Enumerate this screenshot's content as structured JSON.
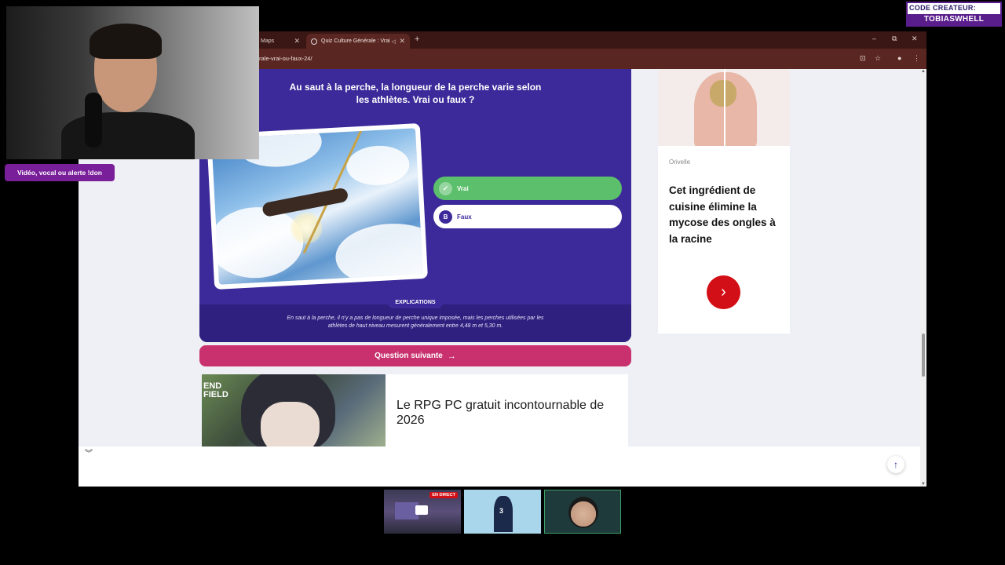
{
  "browser": {
    "tabs": [
      {
        "label": "Maps"
      },
      {
        "label": "Quiz Culture Générale : Vrai"
      }
    ],
    "new_tab": "+",
    "window_controls": {
      "minimize": "–",
      "restore": "⧉",
      "close": "✕"
    },
    "url": "rale-vrai-ou-faux-24/"
  },
  "quiz": {
    "question": "Au saut à la perche, la longueur de la perche varie selon les athlètes. Vrai ou faux ?",
    "answers": [
      {
        "mark": "✓",
        "label": "Vrai",
        "state": "correct"
      },
      {
        "mark": "B",
        "label": "Faux",
        "state": "default"
      }
    ],
    "explanation_title": "EXPLICATIONS",
    "explanation_text": "En saut à la perche, il n'y a pas de longueur de perche unique imposée, mais les perches utilisées par les athlètes de haut niveau mesurent généralement entre 4,48 m et 5,30 m.",
    "next_label": "Question suivante",
    "next_arrow": "→"
  },
  "promo": {
    "logo": "END\nFIELD",
    "text": "Le RPG PC gratuit incontournable de 2026"
  },
  "ad": {
    "brand": "Orivelle",
    "title": "Cet ingrédient de cuisine élimine la mycose des ongles à la racine",
    "button_icon": "chevron-right-icon",
    "button_glyph": "›",
    "adchoice": "▷"
  },
  "page": {
    "collapse_glyph": "︾",
    "scroll_top_glyph": "↑"
  },
  "stream": {
    "alert_text": "Vidéo, vocal ou alerte !don",
    "creator_code_label": "CODE CREATEUR:",
    "creator_code": "TOBIASWHELL",
    "live_badge": "EN DIRECT",
    "jersey_number": "3"
  },
  "colors": {
    "quiz_bg": "#3d2a9a",
    "correct": "#5cbf6c",
    "next_button": "#c8316e",
    "ad_button": "#d20f16",
    "tab_bar": "#3a1714"
  }
}
